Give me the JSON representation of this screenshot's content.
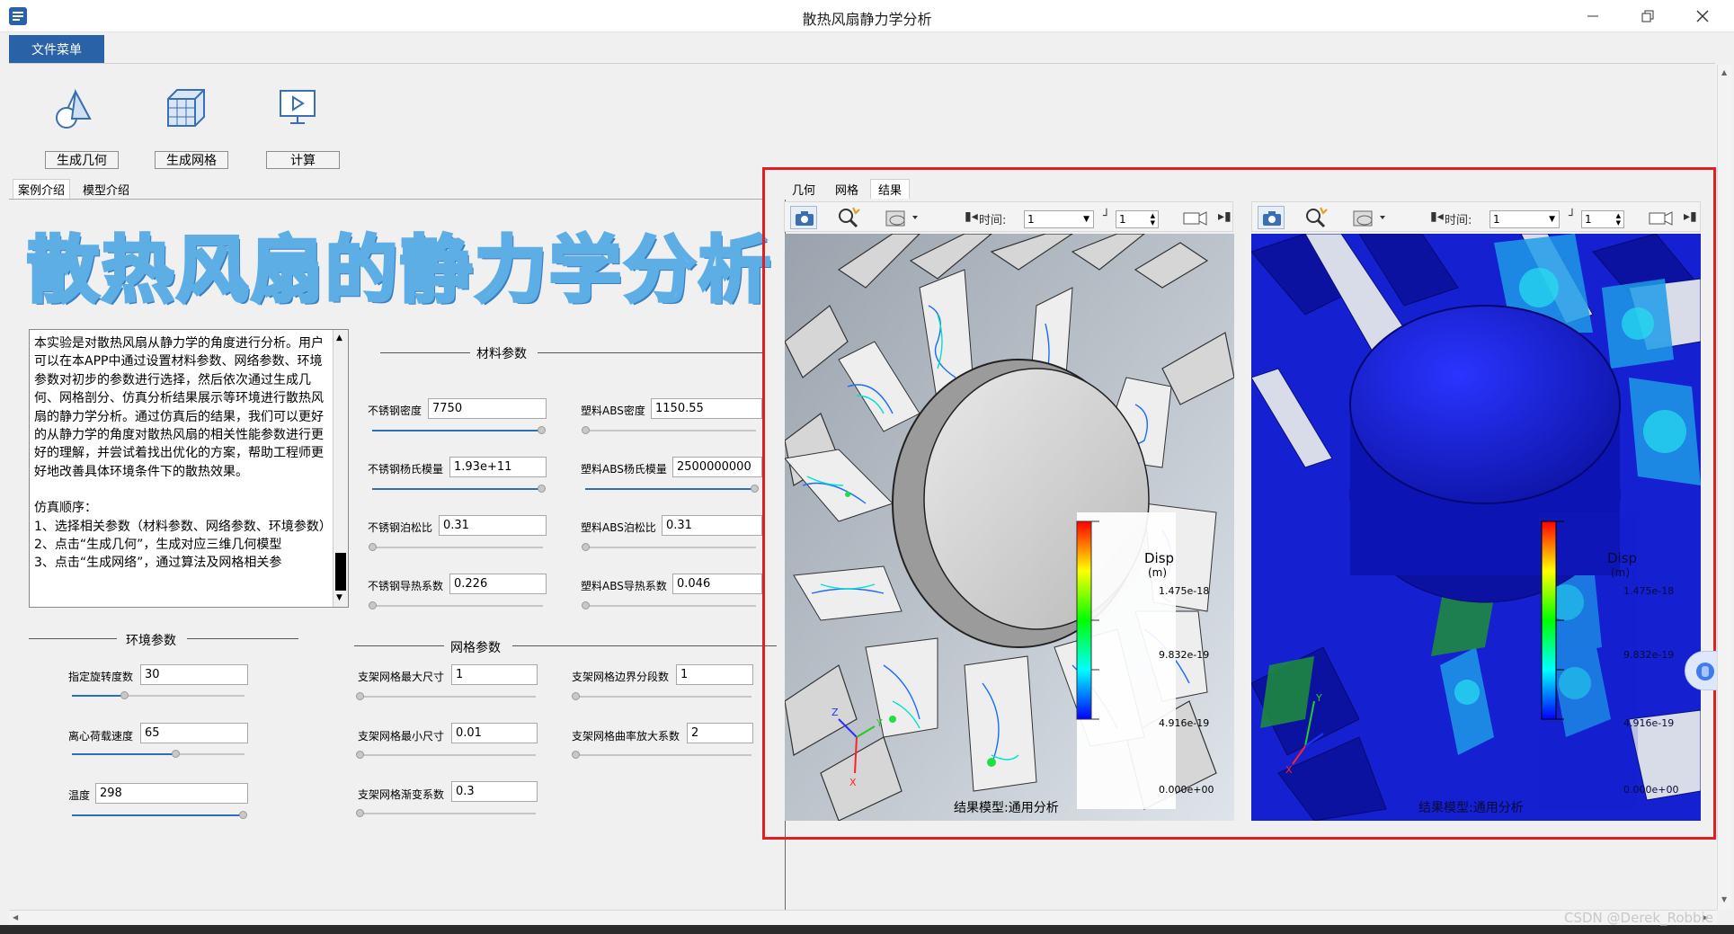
{
  "window": {
    "title": "散热风扇静力学分析"
  },
  "menu": {
    "file_menu": "文件菜单"
  },
  "toolbar": {
    "gen_geometry": "生成几何",
    "gen_mesh": "生成网格",
    "compute": "计算"
  },
  "left_tabs": {
    "case_intro": "案例介绍",
    "model_intro": "模型介绍"
  },
  "banner": {
    "title": "散热风扇的静力学分析"
  },
  "description": {
    "p1": "本实验是对散热风扇从静力学的角度进行分析。用户可以在本APP中通过设置材料参数、网络参数、环境参数对初步的参数进行选择，然后依次通过生成几何、网格剖分、仿真分析结果展示等环境进行散热风扇的静力学分析。通过仿真后的结果，我们可以更好的从静力学的角度对散热风扇的相关性能参数进行更好的理解，并尝试着找出优化的方案，帮助工程师更好地改善具体环境条件下的散热效果。",
    "order_title": "仿真顺序：",
    "s1": "1、选择相关参数（材料参数、网络参数、环境参数）",
    "s2": "2、点击“生成几何”，生成对应三维几何模型",
    "s3": "3、点击“生成网络”，通过算法及网格相关参"
  },
  "material": {
    "title": "材料参数",
    "steel_density_label": "不锈钢密度",
    "steel_density": "7750",
    "steel_young_label": "不锈钢杨氏模量",
    "steel_young": "1.93e+11",
    "steel_poisson_label": "不锈钢泊松比",
    "steel_poisson": "0.31",
    "steel_thermal_label": "不锈钢导热系数",
    "steel_thermal": "0.226",
    "abs_density_label": "塑料ABS密度",
    "abs_density": "1150.55",
    "abs_young_label": "塑料ABS杨氏模量",
    "abs_young": "2500000000",
    "abs_poisson_label": "塑料ABS泊松比",
    "abs_poisson": "0.31",
    "abs_thermal_label": "塑料ABS导热系数",
    "abs_thermal": "0.046"
  },
  "environment": {
    "title": "环境参数",
    "speed_label": "指定旋转度数",
    "speed": "30",
    "load_label": "离心荷载速度",
    "load": "65",
    "temp_label": "温度",
    "temp": "298"
  },
  "mesh": {
    "title": "网格参数",
    "max_label": "支架网格最大尺寸",
    "max": "1",
    "min_label": "支架网格最小尺寸",
    "min": "0.01",
    "grad_label": "支架网格渐变系数",
    "grad": "0.3",
    "edge_label": "支架网格边界分段数",
    "edge": "1",
    "curv_label": "支架网格曲率放大系数",
    "curv": "2"
  },
  "view_tabs": {
    "geometry": "几何",
    "mesh": "网格",
    "result": "结果"
  },
  "viewer": {
    "time_label": "时间:",
    "time_value": "1",
    "step_value": "1",
    "legend_title": "Disp",
    "legend_unit": "(m)",
    "legend_max": "1.475e-18",
    "legend_mid": "9.832e-19",
    "legend_low": "4.916e-19",
    "legend_min": "0.000e+00",
    "caption": "结果模型:通用分析"
  },
  "controls": {
    "slider_fill": [
      0.99,
      0.99,
      0.0,
      0.0,
      0.0,
      0.99,
      0.0,
      0.0,
      0.3,
      0.6,
      0.99,
      0.0,
      0.0,
      0.0,
      0.0,
      0.0
    ]
  },
  "watermark": "CSDN @Derek_Robbie",
  "colors": {
    "accent": "#2a62a8",
    "highlight": "#e02020",
    "mesh_blue": "#1a23d8"
  }
}
